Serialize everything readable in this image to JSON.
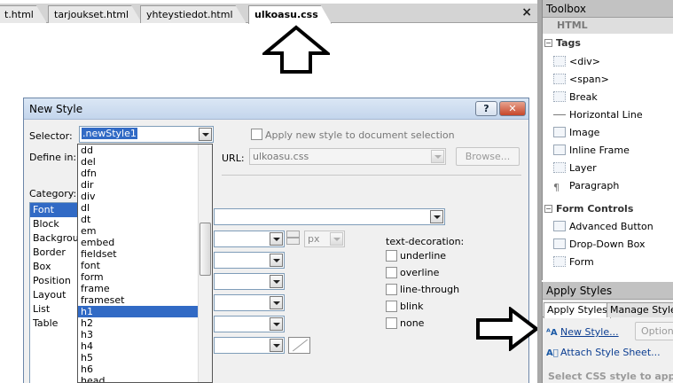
{
  "editor": {
    "tabs": [
      "t.html",
      "tarjoukset.html",
      "yhteystiedot.html",
      "ulkoasu.css"
    ],
    "close_glyph": "×"
  },
  "dialog": {
    "title": "New Style",
    "help_label": "?",
    "close_label": "✕",
    "selector_label": "Selector:",
    "selector_value": ".newStyle1",
    "apply_checkbox_label": "Apply new style to document selection",
    "define_in_label": "Define in:",
    "url_label": "URL:",
    "url_value": "ulkoasu.css",
    "browse_label": "Browse...",
    "category_label": "Category:",
    "categories": [
      "Font",
      "Block",
      "Background",
      "Border",
      "Box",
      "Position",
      "Layout",
      "List",
      "Table"
    ],
    "selected_category": "Font",
    "font_size_unit": "px",
    "text_decoration_label": "text-decoration:",
    "text_decoration_options": [
      "underline",
      "overline",
      "line-through",
      "blink",
      "none"
    ],
    "selector_options": [
      "dd",
      "del",
      "dfn",
      "dir",
      "div",
      "dl",
      "dt",
      "em",
      "embed",
      "fieldset",
      "font",
      "form",
      "frame",
      "frameset",
      "h1",
      "h2",
      "h3",
      "h4",
      "h5",
      "h6",
      "head"
    ],
    "selected_option": "h1"
  },
  "toolbox": {
    "title": "Toolbox",
    "html_section": "HTML",
    "tags_group": "Tags",
    "tags_items": [
      "<div>",
      "<span>",
      "Break",
      "Horizontal Line",
      "Image",
      "Inline Frame",
      "Layer",
      "Paragraph"
    ],
    "form_group": "Form Controls",
    "form_items": [
      "Advanced Button",
      "Drop-Down Box",
      "Form"
    ]
  },
  "apply_styles": {
    "title": "Apply Styles",
    "tabs": [
      "Apply Styles",
      "Manage Styles"
    ],
    "new_style_link": "New Style...",
    "options_label": "Options",
    "attach_link": "Attach Style Sheet...",
    "hint": "Select CSS style to apply:"
  }
}
